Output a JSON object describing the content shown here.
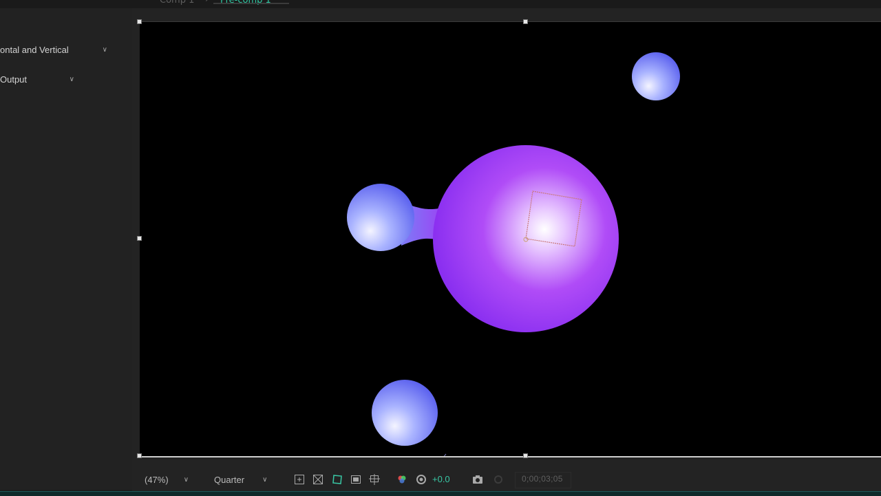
{
  "breadcrumb": {
    "comp_1": "Comp 1",
    "separator": "›",
    "comp_2": "Pre-comp 1"
  },
  "effect_controls": {
    "dimensions_value": "ontal and Vertical",
    "output_value": "Output"
  },
  "viewer": {
    "zoom": "(47%)",
    "resolution": "Quarter",
    "exposure": "+0.0",
    "timecode": "0;00;03;05"
  },
  "icons": {
    "fit": "fit-icon",
    "grid": "grid-icon",
    "mask": "mask-visibility-icon",
    "transparency": "transparency-grid-icon",
    "region": "region-of-interest-icon",
    "color": "color-channel-icon",
    "exposure": "exposure-icon",
    "snapshot": "camera-icon",
    "show_snapshot": "show-snapshot-icon"
  },
  "colors": {
    "accent": "#2fc7a2",
    "blob_main": "#a035f5",
    "blob_small": "#6e7cf5",
    "canvas_bg": "#000000"
  }
}
